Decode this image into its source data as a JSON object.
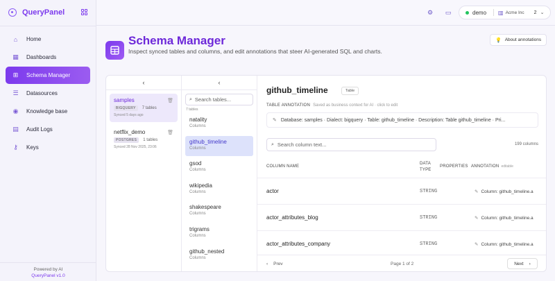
{
  "brand": {
    "name": "QueryPanel"
  },
  "nav": [
    {
      "label": "Home",
      "icon": "home-icon",
      "glyph": "⌂"
    },
    {
      "label": "Dashboards",
      "icon": "dashboard-icon",
      "glyph": "▦"
    },
    {
      "label": "Schema Manager",
      "icon": "table-icon",
      "glyph": "⊞",
      "active": true
    },
    {
      "label": "Datasources",
      "icon": "database-icon",
      "glyph": "☰"
    },
    {
      "label": "Knowledge base",
      "icon": "book-icon",
      "glyph": "◉"
    },
    {
      "label": "Audit Logs",
      "icon": "logs-icon",
      "glyph": "▤"
    },
    {
      "label": "Keys",
      "icon": "key-icon",
      "glyph": "⚷"
    }
  ],
  "footer": {
    "powered": "Powered by AI",
    "version": "QueryPanel v1.0"
  },
  "topbar": {
    "env": "demo",
    "org": "Acme Inc",
    "count": "2"
  },
  "header": {
    "title": "Schema Manager",
    "subtitle": "Inspect synced tables and columns, and edit annotations that steer AI-generated SQL and charts.",
    "about_label": "About annotations"
  },
  "datasources": [
    {
      "name": "samples",
      "dialect": "BIGQUERY",
      "tables": "7 tables",
      "synced": "Synced 5 days ago",
      "selected": true
    },
    {
      "name": "netflix_demo",
      "dialect": "POSTGRES",
      "tables": "1 tables",
      "synced": "Synced 28 Nov 2025, 23:06",
      "selected": false
    }
  ],
  "tables": {
    "search_placeholder": "Search tables...",
    "count": "7 tables",
    "items": [
      {
        "name": "natality",
        "kind": "Columns"
      },
      {
        "name": "github_timeline",
        "kind": "Columns",
        "selected": true
      },
      {
        "name": "gsod",
        "kind": "Columns"
      },
      {
        "name": "wikipedia",
        "kind": "Columns"
      },
      {
        "name": "shakespeare",
        "kind": "Columns"
      },
      {
        "name": "trigrams",
        "kind": "Columns"
      },
      {
        "name": "github_nested",
        "kind": "Columns"
      }
    ]
  },
  "detail": {
    "title": "github_timeline",
    "badge": "Table",
    "ann_label": "TABLE ANNOTATION",
    "ann_hint": "Saved as business context for AI · click to edit",
    "ann_text": "Database: samples · Dialect: bigquery · Table: github_timeline · Description: Table github_timeline · Pri...",
    "col_search_placeholder": "Search column text...",
    "col_count": "199 columns",
    "headers": {
      "name": "COLUMN NAME",
      "type_1": "DATA",
      "type_2": "TYPE",
      "props": "PROPERTIES",
      "ann": "ANNOTATION",
      "ann_hint": "editable"
    },
    "rows": [
      {
        "name": "actor",
        "type": "STRING",
        "ann": "Column: github_timeline.a"
      },
      {
        "name": "actor_attributes_blog",
        "type": "STRING",
        "ann": "Column: github_timeline.a"
      },
      {
        "name": "actor_attributes_company",
        "type": "STRING",
        "ann": "Column: github_timeline.a"
      }
    ],
    "pager": {
      "prev": "Prev",
      "info": "Page 1 of 2",
      "next": "Next"
    }
  }
}
